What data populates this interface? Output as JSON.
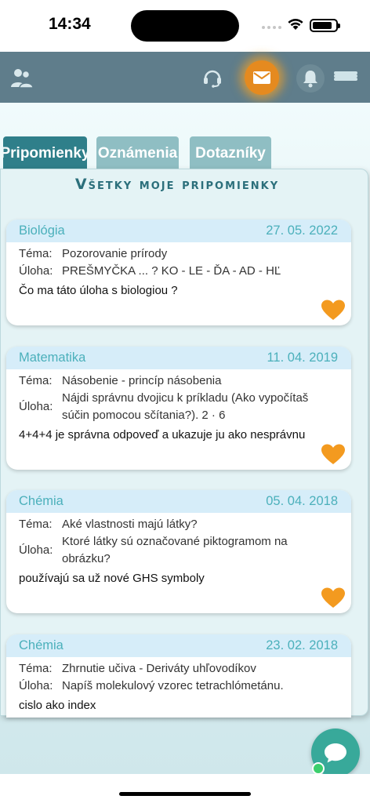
{
  "status_bar": {
    "time": "14:34"
  },
  "tabs": [
    {
      "label": "Pripomienky",
      "active": true
    },
    {
      "label": "Oznámenia",
      "active": false
    },
    {
      "label": "Dotazníky",
      "active": false
    }
  ],
  "panel": {
    "title": "Všetky moje pripomienky"
  },
  "cards": [
    {
      "subject": "Biológia",
      "date": "27. 05. 2022",
      "tema_label": "Téma:",
      "tema": "Pozorovanie prírody",
      "uloha_label": "Úloha:",
      "uloha": "PREŠMYČKA ... ? KO - LE - ĎA - AD - HĽ",
      "note": "Čo ma táto úloha s biologiou ?"
    },
    {
      "subject": "Matematika",
      "date": "11. 04. 2019",
      "tema_label": "Téma:",
      "tema": "Násobenie - princíp násobenia",
      "uloha_label": "Úloha:",
      "uloha": "Nájdi správnu dvojicu k príkladu (Ako vypočítaš súčin pomocou sčítania?). 2 · 6",
      "note": "4+4+4 je správna odpoveď a ukazuje ju ako nesprávnu"
    },
    {
      "subject": "Chémia",
      "date": "05. 04. 2018",
      "tema_label": "Téma:",
      "tema": "Aké vlastnosti majú látky?",
      "uloha_label": "Úloha:",
      "uloha": "Ktoré látky sú označované piktogramom na obrázku?",
      "note": "používajú sa už nové GHS symboly"
    },
    {
      "subject": "Chémia",
      "date": "23. 02. 2018",
      "tema_label": "Téma:",
      "tema": "Zhrnutie učiva - Deriváty uhľovodíkov",
      "uloha_label": "Úloha:",
      "uloha": "Napíš molekulový vzorec tetrachlómetánu.",
      "note": "cislo ako index"
    }
  ],
  "colors": {
    "app_bar": "#5f7d8b",
    "tab_active": "#2f7f8a",
    "tab_inactive": "#8fbec3",
    "card_header": "#d6edf9",
    "subject_text": "#4bb0bb",
    "heart": "#f39a1f",
    "chat_button": "#38a99a",
    "online_dot": "#3ccf6d"
  },
  "icons": {
    "top_left": "users-icon",
    "support": "headset-icon",
    "messages": "envelope-icon",
    "notifications": "bell-icon",
    "menu": "hamburger-menu-icon",
    "favorite": "heart-icon",
    "chat": "chat-bubble-icon"
  }
}
